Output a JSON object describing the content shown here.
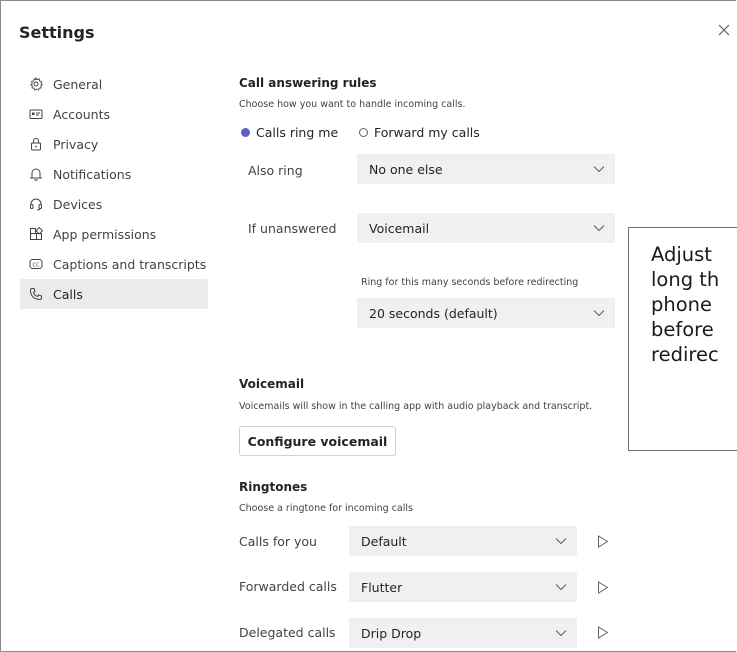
{
  "window": {
    "title": "Settings"
  },
  "sidebar": {
    "items": [
      {
        "label": "General",
        "icon": "gear-icon"
      },
      {
        "label": "Accounts",
        "icon": "id-card-icon"
      },
      {
        "label": "Privacy",
        "icon": "lock-icon"
      },
      {
        "label": "Notifications",
        "icon": "bell-icon"
      },
      {
        "label": "Devices",
        "icon": "headset-icon"
      },
      {
        "label": "App permissions",
        "icon": "apps-grid-icon"
      },
      {
        "label": "Captions and transcripts",
        "icon": "cc-icon"
      },
      {
        "label": "Calls",
        "icon": "phone-icon",
        "active": true
      }
    ]
  },
  "call_answering": {
    "heading": "Call answering rules",
    "description": "Choose how you want to handle incoming calls.",
    "options": [
      {
        "label": "Calls ring me",
        "selected": true
      },
      {
        "label": "Forward my calls",
        "selected": false
      }
    ],
    "also_ring": {
      "label": "Also ring",
      "value": "No one else"
    },
    "if_unanswered": {
      "label": "If unanswered",
      "value": "Voicemail"
    },
    "ring_seconds": {
      "label": "Ring for this many seconds before redirecting",
      "value": "20 seconds (default)"
    }
  },
  "voicemail": {
    "heading": "Voicemail",
    "description": "Voicemails will show in the calling app with audio playback and transcript.",
    "button_label": "Configure voicemail"
  },
  "ringtones": {
    "heading": "Ringtones",
    "description": "Choose a ringtone for incoming calls",
    "rows": [
      {
        "label": "Calls for you",
        "value": "Default"
      },
      {
        "label": "Forwarded calls",
        "value": "Flutter"
      },
      {
        "label": "Delegated calls",
        "value": "Drip Drop"
      }
    ]
  },
  "callout": {
    "lines": [
      "Adjust",
      "long th",
      "phone",
      "before",
      "redirec"
    ]
  },
  "colors": {
    "accent": "#5b5fc7",
    "selected_nav": "#ebebeb",
    "field_bg": "#f0f0f0"
  }
}
